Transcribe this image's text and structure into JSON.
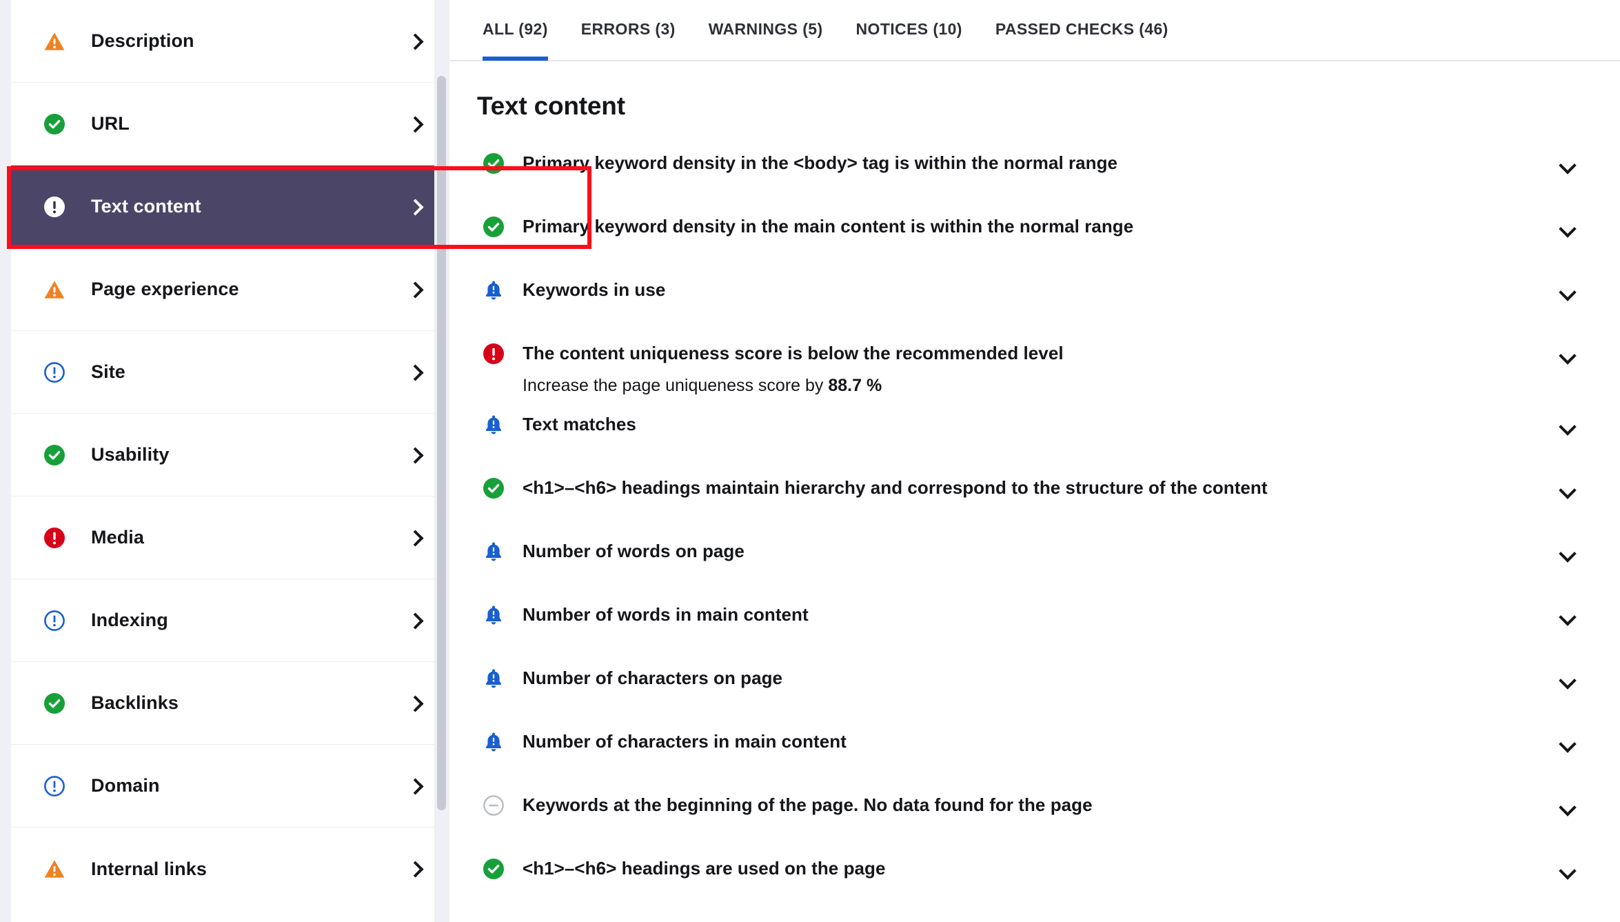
{
  "colors": {
    "selected_nav_bg": "#4b4668",
    "annotation_border": "#fc0d1b",
    "active_tab_underline": "#1a5fd0",
    "success": "#17a039",
    "warning": "#f08223",
    "error": "#d80019",
    "notice": "#1a5fd0",
    "nodata": "#b9bcc4",
    "page_bg": "#eef0f5"
  },
  "sidebar": {
    "items": [
      {
        "label": "Description",
        "status": "warning",
        "chevron": "chevron-right-icon",
        "selected": false
      },
      {
        "label": "URL",
        "status": "success",
        "chevron": "chevron-right-icon",
        "selected": false
      },
      {
        "label": "Text content",
        "status": "error-white",
        "chevron": "chevron-right-icon",
        "selected": true
      },
      {
        "label": "Page experience",
        "status": "warning",
        "chevron": "chevron-right-icon",
        "selected": false
      },
      {
        "label": "Site",
        "status": "info",
        "chevron": "chevron-right-icon",
        "selected": false
      },
      {
        "label": "Usability",
        "status": "success",
        "chevron": "chevron-right-icon",
        "selected": false
      },
      {
        "label": "Media",
        "status": "error",
        "chevron": "chevron-right-icon",
        "selected": false
      },
      {
        "label": "Indexing",
        "status": "info",
        "chevron": "chevron-right-icon",
        "selected": false
      },
      {
        "label": "Backlinks",
        "status": "success",
        "chevron": "chevron-right-icon",
        "selected": false
      },
      {
        "label": "Domain",
        "status": "info",
        "chevron": "chevron-right-icon",
        "selected": false
      },
      {
        "label": "Internal links",
        "status": "warning",
        "chevron": "chevron-right-icon",
        "selected": false
      }
    ],
    "scrollbar": {
      "name": "sidebar-scrollbar"
    }
  },
  "main": {
    "tabs": [
      {
        "label": "ALL (92)",
        "active": true
      },
      {
        "label": "ERRORS (3)",
        "active": false
      },
      {
        "label": "WARNINGS (5)",
        "active": false
      },
      {
        "label": "NOTICES (10)",
        "active": false
      },
      {
        "label": "PASSED CHECKS (46)",
        "active": false
      }
    ],
    "title": "Text content",
    "checks": [
      {
        "status": "success",
        "text": "Primary keyword density in the <body> tag is within the normal range",
        "sub": "",
        "sub_bold": "",
        "expand": "chevron-down-icon"
      },
      {
        "status": "success",
        "text": "Primary keyword density in the main content is within the normal range",
        "sub": "",
        "sub_bold": "",
        "expand": "chevron-down-icon"
      },
      {
        "status": "notice",
        "text": "Keywords in use",
        "sub": "",
        "sub_bold": "",
        "expand": "chevron-down-icon"
      },
      {
        "status": "error",
        "text": "The content uniqueness score is below the recommended level",
        "sub": "Increase the page uniqueness score by ",
        "sub_bold": "88.7 %",
        "expand": "chevron-down-icon"
      },
      {
        "status": "notice",
        "text": "Text matches",
        "sub": "",
        "sub_bold": "",
        "expand": "chevron-down-icon"
      },
      {
        "status": "success",
        "text": "<h1>–<h6> headings maintain hierarchy and correspond to the structure of the content",
        "sub": "",
        "sub_bold": "",
        "expand": "chevron-down-icon"
      },
      {
        "status": "notice",
        "text": "Number of words on page",
        "sub": "",
        "sub_bold": "",
        "expand": "chevron-down-icon"
      },
      {
        "status": "notice",
        "text": "Number of words in main content",
        "sub": "",
        "sub_bold": "",
        "expand": "chevron-down-icon"
      },
      {
        "status": "notice",
        "text": "Number of characters on page",
        "sub": "",
        "sub_bold": "",
        "expand": "chevron-down-icon"
      },
      {
        "status": "notice",
        "text": "Number of characters in main content",
        "sub": "",
        "sub_bold": "",
        "expand": "chevron-down-icon"
      },
      {
        "status": "nodata",
        "text": "Keywords at the beginning of the page. No data found for the page",
        "sub": "",
        "sub_bold": "",
        "expand": "chevron-down-icon"
      },
      {
        "status": "success",
        "text": "<h1>–<h6> headings are used on the page",
        "sub": "",
        "sub_bold": "",
        "expand": "chevron-down-icon"
      }
    ]
  }
}
